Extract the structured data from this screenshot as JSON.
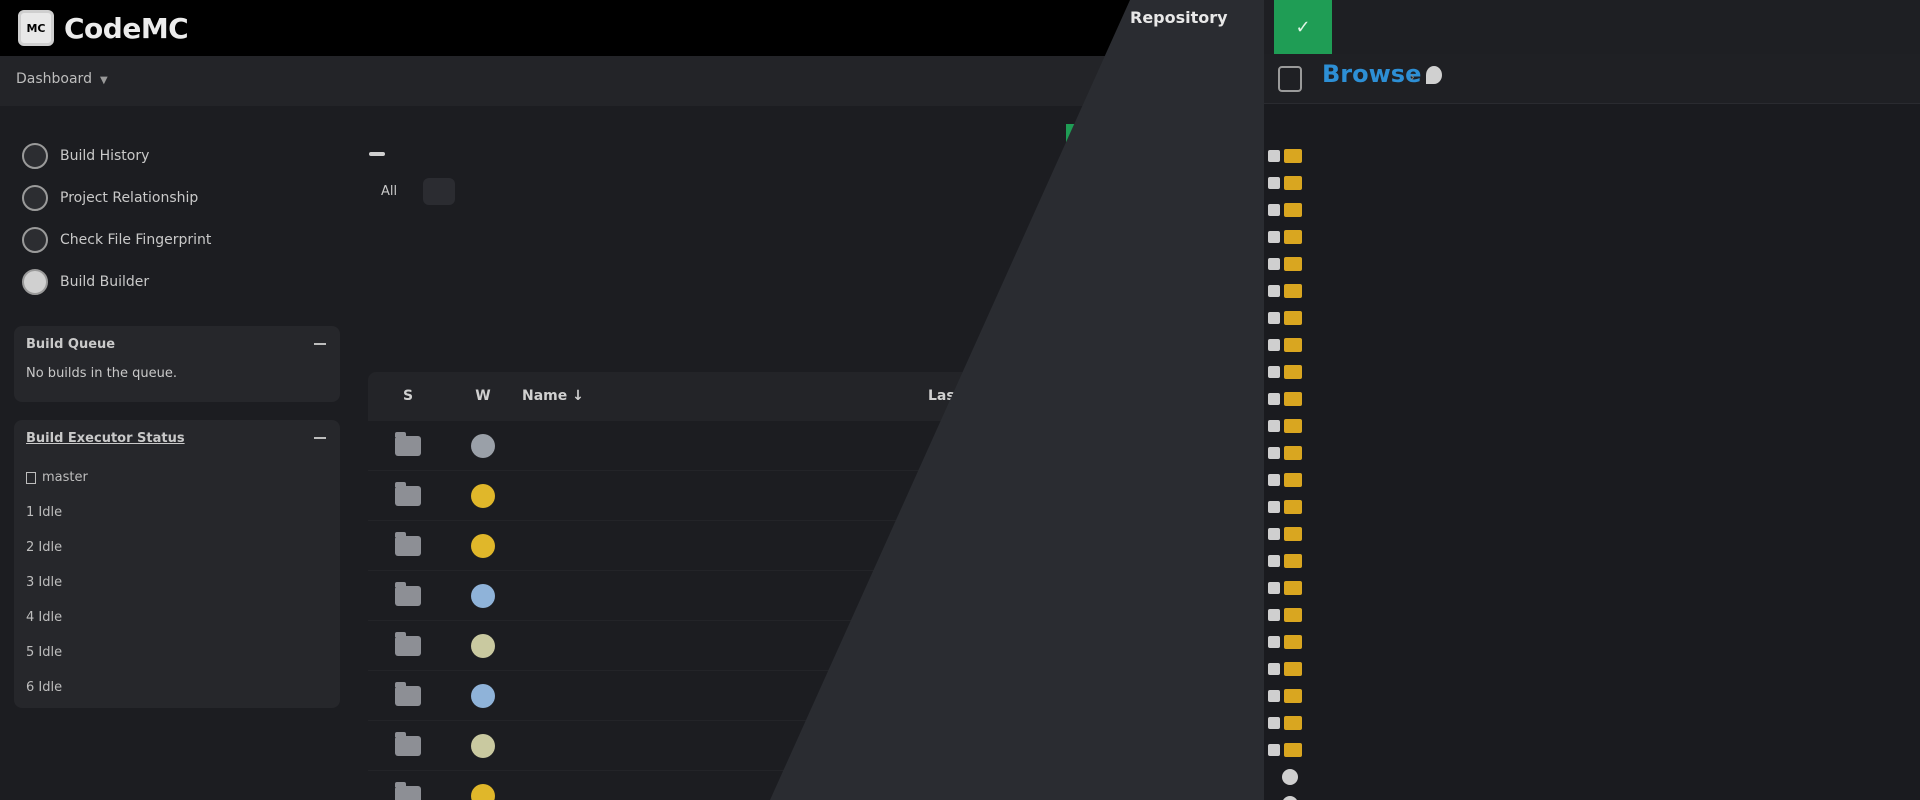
{
  "jenkins": {
    "brand": "CodeMC",
    "breadcrumb": "Dashboard",
    "side_tasks": [
      "Build History",
      "Project Relationship",
      "Check File Fingerprint",
      "Build Builder"
    ],
    "build_queue": {
      "title": "Build Queue",
      "empty_text": "No builds in the queue."
    },
    "executor_status": {
      "title": "Build Executor Status",
      "node": "master",
      "executors": [
        "1 Idle",
        "2 Idle",
        "3 Idle",
        "4 Idle",
        "5 Idle",
        "6 Idle"
      ]
    },
    "welcome": "",
    "sponsor_text": "",
    "sponsor_logo": "",
    "links": [
      {
        "label": "",
        "url": ""
      },
      {
        "label": "",
        "url": ""
      },
      {
        "label": "",
        "url": ""
      },
      {
        "label": "",
        "url": ""
      }
    ],
    "tabs": [
      "All",
      ""
    ],
    "columns": {
      "s": "S",
      "w": "W",
      "name": "Name ↓",
      "last": "Last"
    },
    "jobs": [
      {
        "name": "",
        "weather_color": "#9aa0a8"
      },
      {
        "name": "",
        "weather_color": "#e0b72a"
      },
      {
        "name": "",
        "weather_color": "#e0b72a"
      },
      {
        "name": "",
        "weather_color": "#8fb3d9"
      },
      {
        "name": "",
        "weather_color": "#c9c9a0"
      },
      {
        "name": "",
        "weather_color": "#8fb3d9"
      },
      {
        "name": "",
        "weather_color": "#c9c9a0"
      },
      {
        "name": "",
        "weather_color": "#e0b72a"
      }
    ]
  },
  "browser": {
    "repository_label": "Repository",
    "title": "Browse",
    "repo_selector": "",
    "subbar": "",
    "tree_folders": [
      "",
      "",
      "",
      "",
      "",
      "",
      "",
      "",
      "",
      "",
      "",
      "",
      "",
      "",
      "",
      "",
      "",
      "",
      "",
      "",
      "",
      "",
      ""
    ],
    "tree_files": [
      "",
      ""
    ]
  }
}
